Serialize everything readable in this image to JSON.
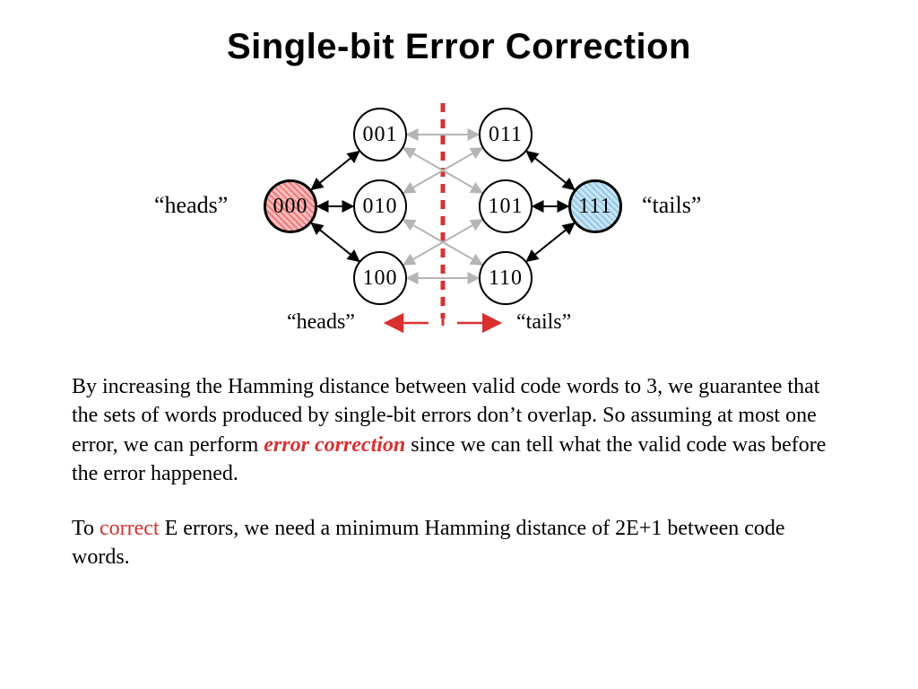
{
  "title": "Single-bit Error Correction",
  "labels": {
    "heads_left": "“heads”",
    "tails_right": "“tails”",
    "heads_bottom": "“heads”",
    "tails_bottom": "“tails”"
  },
  "nodes": {
    "n000": "000",
    "n001": "001",
    "n010": "010",
    "n100": "100",
    "n011": "011",
    "n101": "101",
    "n110": "110",
    "n111": "111"
  },
  "body": {
    "p1a": "By increasing the Hamming distance between valid code words to 3, we guarantee that the sets of words produced by single-bit errors don’t overlap.  So assuming at most one error, we can perform ",
    "p1em": "error correction",
    "p1b": " since we can tell what the valid code was before the error happened.",
    "p2a": "To ",
    "p2red": "correct",
    "p2b": " E errors, we need a minimum Hamming distance of 2E+1 between code words."
  },
  "chart_data": {
    "type": "diagram",
    "description": "Hamming distance-3 code for single-bit error correction. Two valid codewords 000 (heads) and 111 (tails); each is Hamming-distance 1 from three error words which form disjoint sets separated by the dashed boundary.",
    "codewords": [
      {
        "label": "heads",
        "code": "000",
        "neighbors": [
          "001",
          "010",
          "100"
        ]
      },
      {
        "label": "tails",
        "code": "111",
        "neighbors": [
          "011",
          "101",
          "110"
        ]
      }
    ],
    "cross_edges_faint": [
      [
        "001",
        "011"
      ],
      [
        "001",
        "101"
      ],
      [
        "010",
        "011"
      ],
      [
        "010",
        "110"
      ],
      [
        "100",
        "101"
      ],
      [
        "100",
        "110"
      ]
    ],
    "rule": "To correct E errors, need minimum Hamming distance 2E+1."
  }
}
